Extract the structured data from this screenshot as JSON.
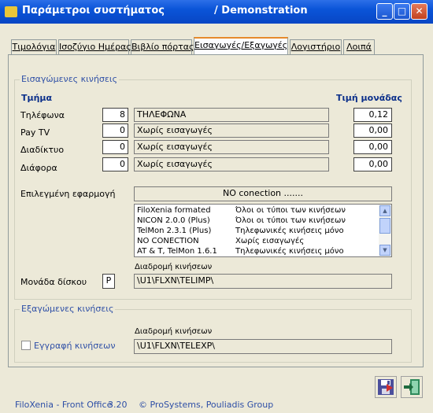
{
  "window": {
    "title": "Παράμετροι συστήματος",
    "subtitle": "/ Demonstration",
    "min_glyph": "_",
    "max_glyph": "□",
    "close_glyph": "✕"
  },
  "tabs": [
    {
      "label": "Τιμολόγια"
    },
    {
      "label": "Ισοζύγιο Ημέρας"
    },
    {
      "label": "Βιβλίο πόρτας"
    },
    {
      "label": "Εισαγωγές/Εξαγωγές",
      "active": true
    },
    {
      "label": "Λογιστήριο"
    },
    {
      "label": "Λοιπά"
    }
  ],
  "imports": {
    "group_title": "Εισαγώμενες κινήσεις",
    "dept_header": "Τμήμα",
    "price_header": "Τιμή μονάδας",
    "rows": [
      {
        "label": "Τηλέφωνα",
        "code": "8",
        "description": "ΤΗΛΕΦΩΝΑ",
        "price": "0,12"
      },
      {
        "label": "Pay TV",
        "code": "0",
        "description": "Χωρίς εισαγωγές",
        "price": "0,00"
      },
      {
        "label": "Διαδίκτυο",
        "code": "0",
        "description": "Χωρίς εισαγωγές",
        "price": "0,00"
      },
      {
        "label": "Διάφορα",
        "code": "0",
        "description": "Χωρίς εισαγωγές",
        "price": "0,00"
      }
    ],
    "app_label": "Επιλεγμένη εφαρμογή",
    "app_selected": "NO conection .......",
    "app_list": [
      {
        "name": "FiloXenia formated",
        "desc": "Όλοι οι τύποι των κινήσεων"
      },
      {
        "name": "NICON 2.0.0 (Plus)",
        "desc": "Όλοι οι τύποι των κινήσεων"
      },
      {
        "name": "TelMon 2.3.1 (Plus)",
        "desc": "Τηλεφωνικές κινήσεις μόνο"
      },
      {
        "name": "NO CONECTION",
        "desc": "Χωρίς εισαγωγές"
      },
      {
        "name": "AT & T, TelMon 1.6.1",
        "desc": "Τηλεφωνικές κινήσεις μόνο"
      }
    ],
    "path_label": "Διαδρομή κινήσεων",
    "disk_label": "Μονάδα δίσκου",
    "disk_value": "P",
    "path_value": "\\U1\\FLXN\\TELIMP\\"
  },
  "exports": {
    "group_title": "Εξαγώμενες κινήσεις",
    "path_label": "Διαδρομή κινήσεων",
    "checkbox_label": "Εγγραφή κινήσεων",
    "checkbox_checked": false,
    "path_value": "\\U1\\FLXN\\TELEXP\\"
  },
  "footer": {
    "app": "FiloXenia - Front Office",
    "version": "3.20",
    "copyright": "© ProSystems, Pouliadis Group"
  },
  "buttons": {
    "save_icon": "save-disk-icon",
    "exit_icon": "exit-door-icon"
  }
}
